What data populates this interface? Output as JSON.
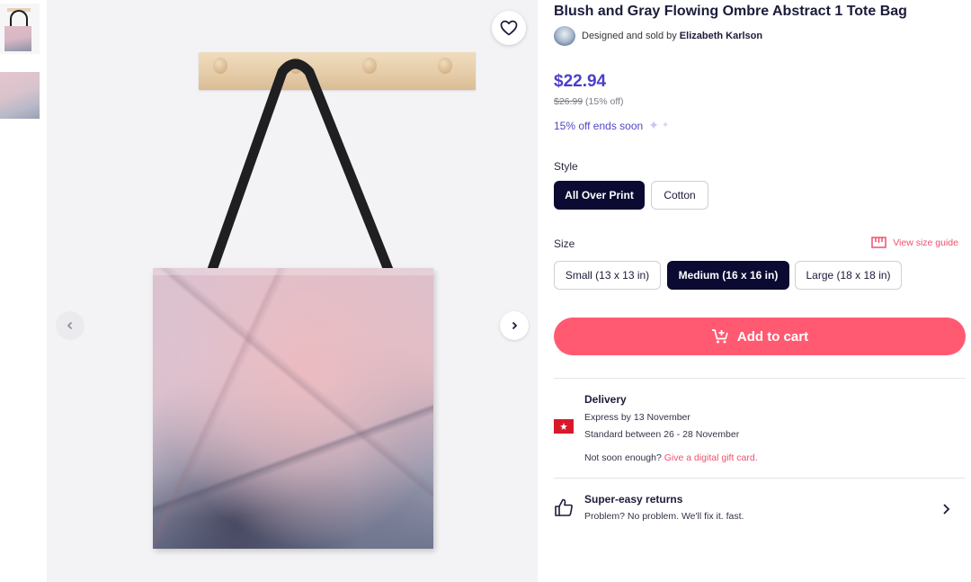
{
  "product": {
    "title": "Blush and Gray Flowing Ombre Abstract 1 Tote Bag",
    "seller_prefix": "Designed and sold by",
    "seller_name": "Elizabeth Karlson",
    "price": "$22.94",
    "old_price": "$26.99",
    "discount": "(15% off)",
    "promo": "15% off ends soon"
  },
  "style": {
    "label": "Style",
    "options": [
      "All Over Print",
      "Cotton"
    ],
    "selected": "All Over Print"
  },
  "size": {
    "label": "Size",
    "guide_label": "View size guide",
    "options": [
      "Small (13 x 13 in)",
      "Medium (16 x 16 in)",
      "Large (18 x 18 in)"
    ],
    "selected": "Medium (16 x 16 in)"
  },
  "cart": {
    "label": "Add to cart"
  },
  "delivery": {
    "title": "Delivery",
    "express": "Express by 13 November",
    "standard": "Standard between 26 - 28 November",
    "not_soon": "Not soon enough?",
    "gift_link": "Give a digital gift card."
  },
  "returns": {
    "title": "Super-easy returns",
    "text": "Problem? No problem. We'll fix it. fast."
  },
  "icons": {
    "wishlist": "heart-icon",
    "prev": "chevron-left-icon",
    "next": "chevron-right-icon",
    "size_guide": "ruler-icon",
    "cart": "cart-add-icon",
    "flag": "hong-kong-flag-icon",
    "returns": "thumbs-up-icon",
    "returns_more": "chevron-right-icon"
  },
  "colors": {
    "accent": "#4b3fc9",
    "cart_button": "#ff5a72",
    "link": "#f0506e",
    "selected_chip": "#0a0a32"
  }
}
